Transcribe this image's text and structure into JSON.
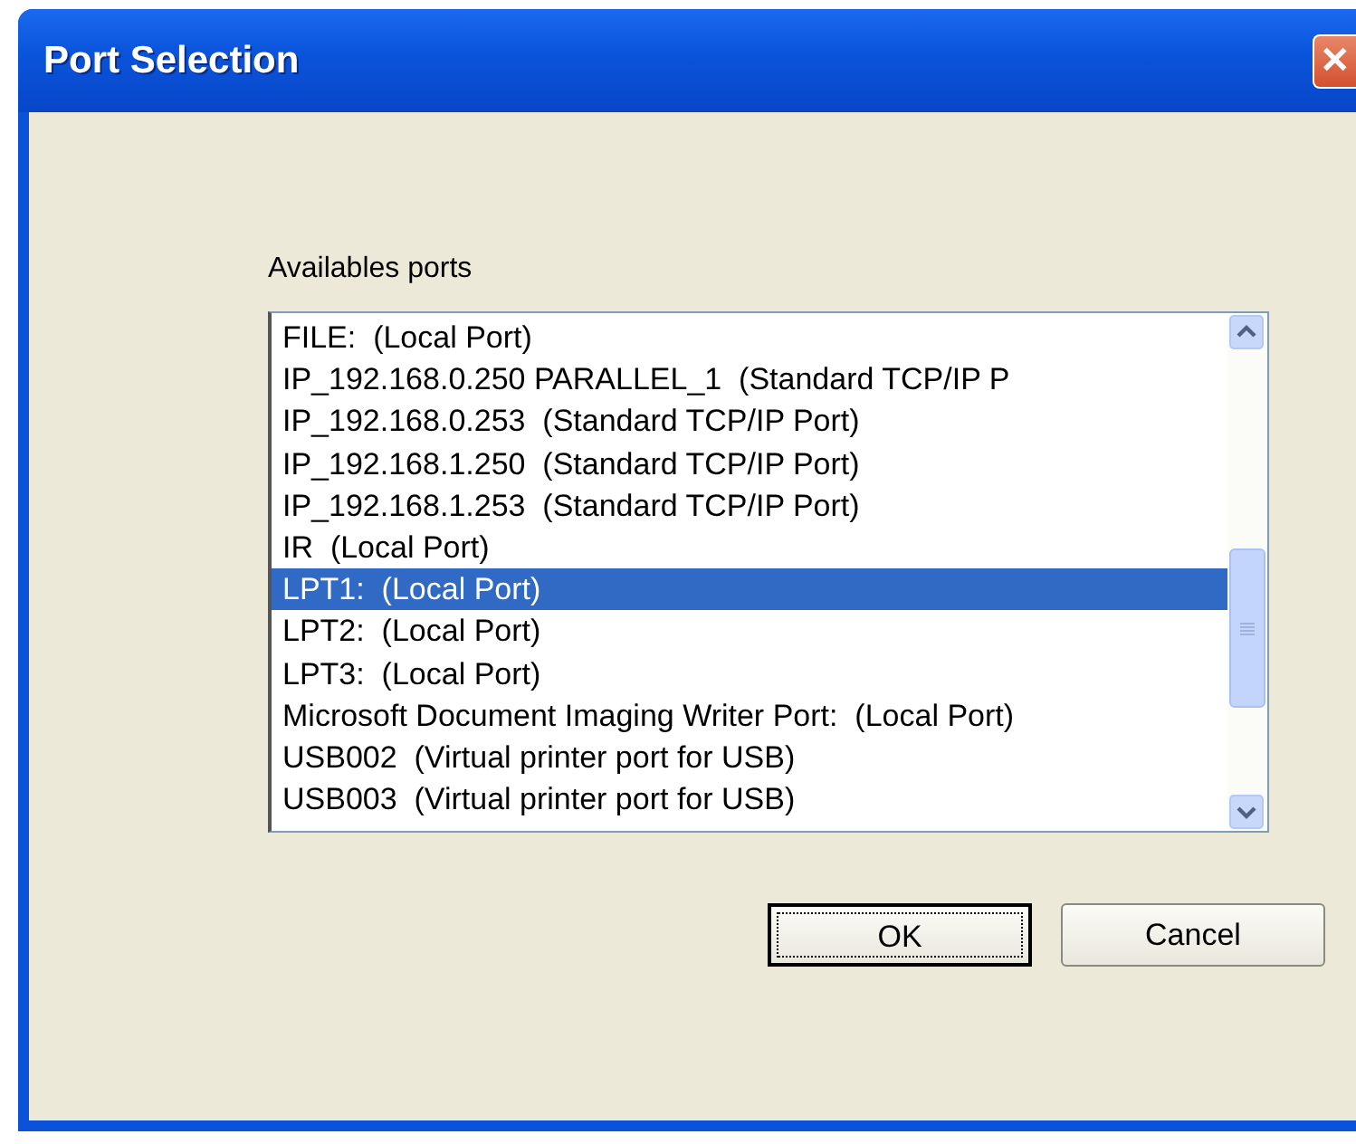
{
  "window": {
    "title": "Port Selection",
    "close_symbol": "✕"
  },
  "ports_label": "Availables ports",
  "ports": [
    {
      "label": "FILE:  (Local Port)",
      "selected": false
    },
    {
      "label": "IP_192.168.0.250 PARALLEL_1  (Standard TCP/IP P",
      "selected": false
    },
    {
      "label": "IP_192.168.0.253  (Standard TCP/IP Port)",
      "selected": false
    },
    {
      "label": "IP_192.168.1.250  (Standard TCP/IP Port)",
      "selected": false
    },
    {
      "label": "IP_192.168.1.253  (Standard TCP/IP Port)",
      "selected": false
    },
    {
      "label": "IR  (Local Port)",
      "selected": false
    },
    {
      "label": "LPT1:  (Local Port)",
      "selected": true
    },
    {
      "label": "LPT2:  (Local Port)",
      "selected": false
    },
    {
      "label": "LPT3:  (Local Port)",
      "selected": false
    },
    {
      "label": "Microsoft Document Imaging Writer Port:  (Local Port)",
      "selected": false
    },
    {
      "label": "USB002  (Virtual printer port for USB)",
      "selected": false
    },
    {
      "label": "USB003  (Virtual printer port for USB)",
      "selected": false
    }
  ],
  "buttons": [
    {
      "label": "OK",
      "kind": "default"
    },
    {
      "label": "Cancel",
      "kind": "normal"
    }
  ]
}
